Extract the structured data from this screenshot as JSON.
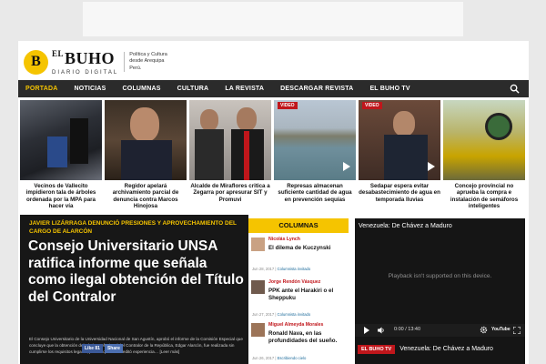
{
  "brand": {
    "logo_letter": "B",
    "el": "EL",
    "name": "BUHO",
    "sub": "DIARIO DIGITAL",
    "tagline": "Política y Cultura desde Arequipa Perú."
  },
  "nav": {
    "items": [
      "PORTADA",
      "NOTICIAS",
      "COLUMNAS",
      "CULTURA",
      "LA REVISTA",
      "DESCARGAR REVISTA",
      "EL BUHO TV"
    ],
    "active_index": 0,
    "search_icon": "search-icon"
  },
  "thumbs": [
    {
      "caption": "Vecinos de Vallecito impidieron tala de árboles ordenada por la MPA para hacer vía",
      "video": false
    },
    {
      "caption": "Regidor apelará archivamiento parcial de denuncia contra Marcos Hinojosa",
      "video": false
    },
    {
      "caption": "Alcalde de Miraflores critica a Zegarra por apresurar SIT y Promuvi",
      "video": false
    },
    {
      "caption": "Represas almacenan suficiente cantidad de agua en prevención sequías",
      "video": true
    },
    {
      "caption": "Sedapar espera evitar desabastecimiento de agua en temporada lluvias",
      "video": true
    },
    {
      "caption": "Concejo provincial no aprueba la compra e instalación de semáforos inteligentes",
      "video": false
    }
  ],
  "video_badge": "VIDEO",
  "feature": {
    "kicker": "JAVIER LIZÁRRAGA DENUNCIÓ PRESIONES Y APROVECHAMIENTO DEL CARGO DE ALARCÓN",
    "headline": "Consejo Universitario UNSA ratifica informe que señala como ilegal obtención del Título del Contralor",
    "summary": "El Consejo Universitario de la Universidad Nacional de San Agustín, aprobó el informe de la Comisión Especial que concluye que la obtención del Título Profesional del Contralor de la República, Edgar Alarcón, fue realizada sin cumplirse los requisitos legales, puesto que no acreditó experiencia… [Leer más]",
    "like_label": "Like 81",
    "share_label": "Share"
  },
  "columns": {
    "heading": "COLUMNAS",
    "items": [
      {
        "author": "Nicolás Lynch",
        "title": "El dilema de Kuczynski",
        "date": "Jun 28, 2017",
        "tag": "Columnista invitado"
      },
      {
        "author": "Jorge Rendón Vásquez",
        "title": "PPK ante el Harakiri o el Sheppuku",
        "date": "Jun 27, 2017",
        "tag": "Columnista invitado"
      },
      {
        "author": "Miguel Almeyda Morales",
        "title": "Ronald Nava, en las profundidades del sueño.",
        "date": "Jun 26, 2017",
        "tag": "Escribiendo cielo"
      }
    ]
  },
  "video": {
    "title": "Venezuela: De Chávez a Maduro",
    "unsupported": "Playback isn't supported on this device.",
    "time": "0:00 / 13:40",
    "youtube_label": "YouTube",
    "footer_badge": "EL BUHO TV",
    "footer_title": "Venezuela: De Chávez a Maduro"
  }
}
